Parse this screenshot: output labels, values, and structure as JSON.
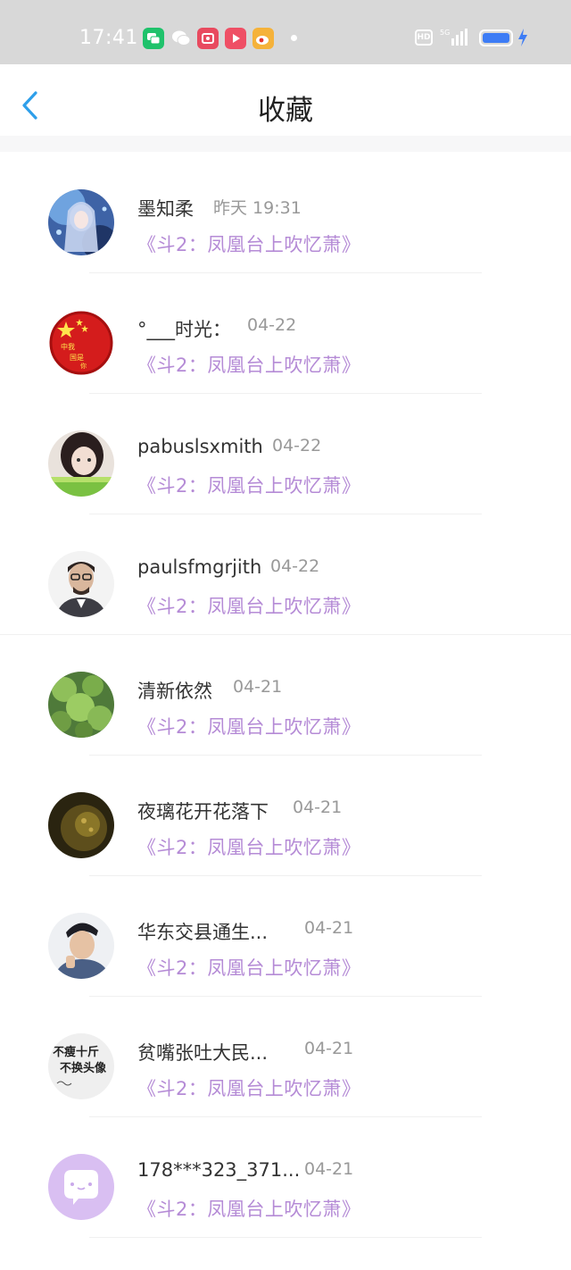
{
  "status_bar": {
    "time": "17:41",
    "hd": "HD",
    "network": "5G",
    "icons": [
      "messages-icon",
      "wechat-icon",
      "scan-app-icon",
      "video-app-icon",
      "weibo-icon"
    ]
  },
  "header": {
    "title": "收藏",
    "back_icon": "chevron-left-icon"
  },
  "colors": {
    "accent": "#2e9fea",
    "link": "#b58bd6",
    "time": "#999999",
    "status_bar_bg": "#d8d8d8"
  },
  "items": [
    {
      "name": "墨知柔",
      "time": "昨天 19:31",
      "link": "《斗2：凤凰台上吹忆萧》"
    },
    {
      "name": "°___时光：",
      "time": "04-22",
      "link": "《斗2：凤凰台上吹忆萧》"
    },
    {
      "name": "pabuslsxmith",
      "time": "04-22",
      "link": "《斗2：凤凰台上吹忆萧》"
    },
    {
      "name": "paulsfmgrjith",
      "time": "04-22",
      "link": "《斗2：凤凰台上吹忆萧》"
    },
    {
      "name": "清新依然",
      "time": "04-21",
      "link": "《斗2：凤凰台上吹忆萧》"
    },
    {
      "name": "夜璃花开花落下",
      "time": "04-21",
      "link": "《斗2：凤凰台上吹忆萧》"
    },
    {
      "name": "华东交县通生...",
      "time": "04-21",
      "link": "《斗2：凤凰台上吹忆萧》"
    },
    {
      "name": "贫嘴张吐大民...",
      "time": "04-21",
      "link": "《斗2：凤凰台上吹忆萧》"
    },
    {
      "name": "178***323_371...",
      "time": "04-21",
      "link": "《斗2：凤凰台上吹忆萧》"
    }
  ],
  "avatar_texts": {
    "flag_avatar": "中我国是你",
    "slogan_avatar_line1": "不瘦十斤",
    "slogan_avatar_line2": "不换头像"
  }
}
